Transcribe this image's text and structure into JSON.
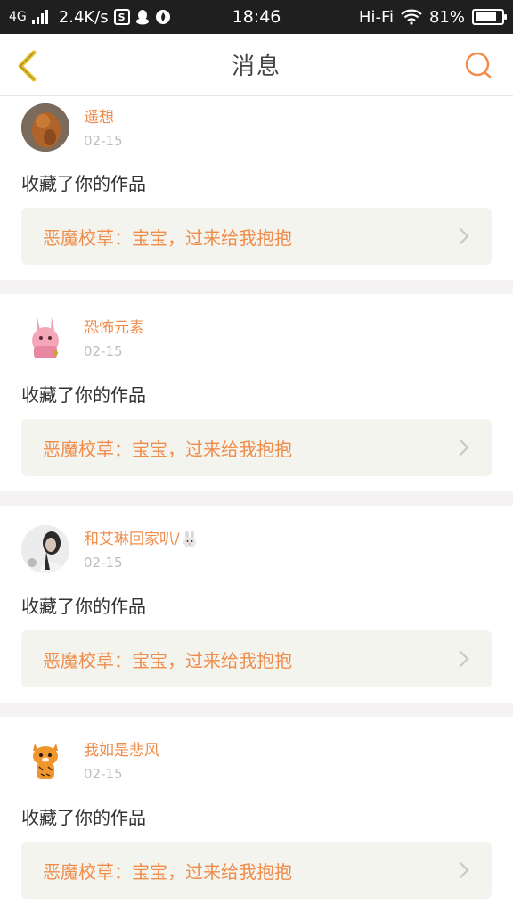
{
  "status_bar": {
    "network": "4G",
    "speed": "2.4K/s",
    "time": "18:46",
    "audio": "Hi-Fi",
    "battery": "81%",
    "battery_level": 0.81
  },
  "header": {
    "title": "消息"
  },
  "messages": [
    {
      "username": "遥想",
      "date": "02-15",
      "action": "收藏了你的作品",
      "work_title": "恶魔校草：宝宝，过来给我抱抱"
    },
    {
      "username": "恐怖元素",
      "date": "02-15",
      "action": "收藏了你的作品",
      "work_title": "恶魔校草：宝宝，过来给我抱抱"
    },
    {
      "username": "和艾琳回家叭/",
      "date": "02-15",
      "action": "收藏了你的作品",
      "work_title": "恶魔校草：宝宝，过来给我抱抱"
    },
    {
      "username": "我如是悲风",
      "date": "02-15",
      "action": "收藏了你的作品",
      "work_title": "恶魔校草：宝宝，过来给我抱抱"
    }
  ],
  "colors": {
    "accent": "#f08c4b",
    "back_icon": "#e8c12a",
    "card_bg": "#f4f4ee"
  }
}
